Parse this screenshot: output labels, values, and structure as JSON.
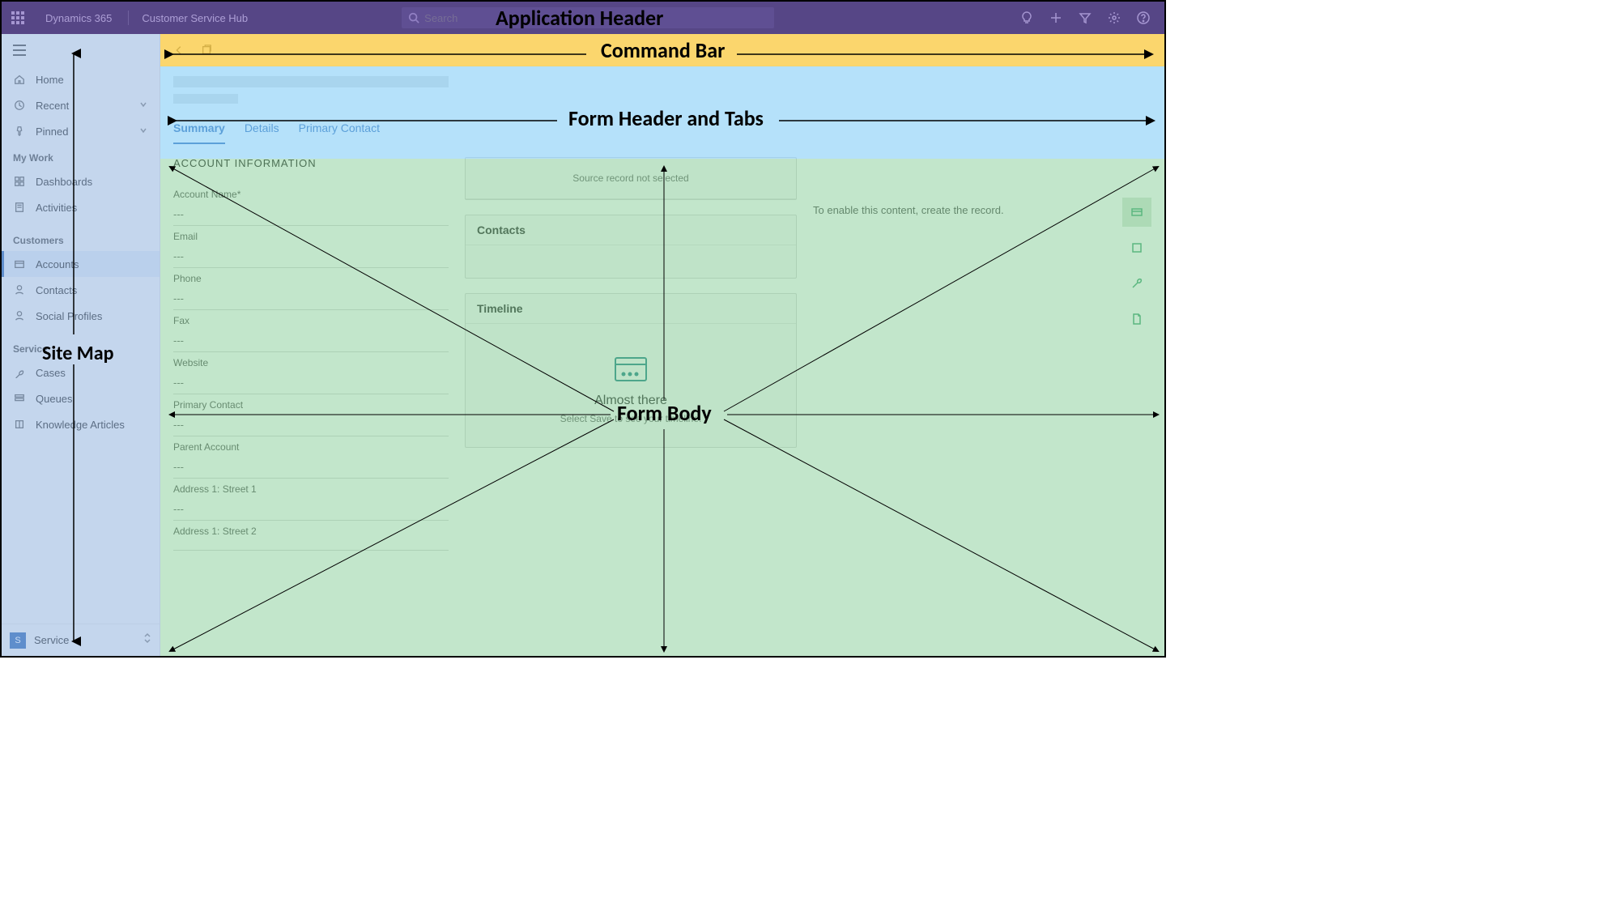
{
  "header": {
    "brand": "Dynamics 365",
    "appName": "Customer Service Hub",
    "searchPlaceholder": "Search"
  },
  "annotations": {
    "appHeader": "Application Header",
    "commandBar": "Command Bar",
    "formHeader": "Form Header and Tabs",
    "siteMap": "Site Map",
    "formBody": "Form Body"
  },
  "sitemap": {
    "topItems": [
      {
        "icon": "home",
        "label": "Home"
      },
      {
        "icon": "clock",
        "label": "Recent",
        "chevron": true
      },
      {
        "icon": "pin",
        "label": "Pinned",
        "chevron": true
      }
    ],
    "groups": [
      {
        "title": "My Work",
        "items": [
          {
            "icon": "dashboard",
            "label": "Dashboards"
          },
          {
            "icon": "activity",
            "label": "Activities"
          }
        ]
      },
      {
        "title": "Customers",
        "items": [
          {
            "icon": "account",
            "label": "Accounts",
            "selected": true
          },
          {
            "icon": "contact",
            "label": "Contacts"
          },
          {
            "icon": "social",
            "label": "Social Profiles"
          }
        ]
      },
      {
        "title": "Service",
        "items": [
          {
            "icon": "case",
            "label": "Cases"
          },
          {
            "icon": "queue",
            "label": "Queues"
          },
          {
            "icon": "kb",
            "label": "Knowledge Articles"
          }
        ]
      }
    ],
    "footer": {
      "badge": "S",
      "label": "Service"
    }
  },
  "tabs": [
    {
      "label": "Summary",
      "active": true
    },
    {
      "label": "Details"
    },
    {
      "label": "Primary Contact"
    }
  ],
  "accountInfo": {
    "sectionTitle": "ACCOUNT INFORMATION",
    "fields": [
      {
        "label": "Account Name*",
        "value": "---"
      },
      {
        "label": "Email",
        "value": "---"
      },
      {
        "label": "Phone",
        "value": "---"
      },
      {
        "label": "Fax",
        "value": "---"
      },
      {
        "label": "Website",
        "value": "---"
      },
      {
        "label": "Primary Contact",
        "value": "---"
      },
      {
        "label": "Parent Account",
        "value": "---"
      },
      {
        "label": "Address 1: Street 1",
        "value": "---"
      },
      {
        "label": "Address 1: Street 2",
        "value": ""
      }
    ]
  },
  "midColumn": {
    "sourceEmpty": "Source record not selected",
    "contactsTitle": "Contacts",
    "timelineTitle": "Timeline",
    "timelineHeading": "Almost there",
    "timelineSub": "Select Save to see your timeline."
  },
  "rightColumn": {
    "note": "To enable this content, create the record."
  }
}
